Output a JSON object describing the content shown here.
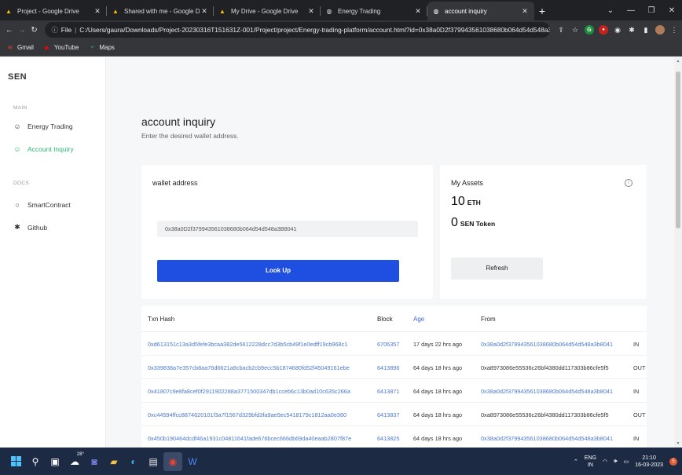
{
  "browser": {
    "tabs": [
      {
        "title": "Project - Google Drive",
        "icon": "google-drive-icon",
        "active": false
      },
      {
        "title": "Shared with me - Google Drive",
        "icon": "google-drive-icon",
        "active": false
      },
      {
        "title": "My Drive - Google Drive",
        "icon": "google-drive-icon",
        "active": false
      },
      {
        "title": "Energy Trading",
        "icon": "globe-icon",
        "active": false
      },
      {
        "title": "account inquiry",
        "icon": "globe-icon",
        "active": true
      }
    ],
    "address": {
      "scheme_label": "File",
      "url": "C:/Users/gaura/Downloads/Project-20230316T151631Z-001/Project/project/Energy-trading-platform/account.html?id=0x38a0D2f379943561038680b064d54d548a3B80..."
    },
    "bookmarks": [
      {
        "label": "Gmail",
        "icon": "gmail-icon"
      },
      {
        "label": "YouTube",
        "icon": "youtube-icon"
      },
      {
        "label": "Maps",
        "icon": "maps-icon"
      }
    ]
  },
  "sidebar": {
    "brand": "SEN",
    "main_label": "MAIN",
    "docs_label": "DOCS",
    "items": [
      {
        "label": "Energy Trading",
        "icon": "bulb-icon",
        "active": false
      },
      {
        "label": "Account Inquiry",
        "icon": "bulb-icon",
        "active": true
      },
      {
        "label": "SmartContract",
        "icon": "circle-icon",
        "active": false
      },
      {
        "label": "Github",
        "icon": "asterisk-icon",
        "active": false
      }
    ]
  },
  "main": {
    "title": "account inquiry",
    "subtitle": "Enter the desired wallet address.",
    "wallet": {
      "label": "wallet address",
      "value": "0x38a0D2f379943561038680b064d54d548a3B8041",
      "button": "Look Up"
    },
    "assets": {
      "title": "My Assets",
      "eth_amount": "10",
      "eth_unit": "ETH",
      "token_amount": "0",
      "token_unit": "SEN Token",
      "refresh": "Refresh"
    },
    "table": {
      "headers": {
        "hash": "Txn Hash",
        "block": "Block",
        "age": "Age",
        "from": "From"
      },
      "rows": [
        {
          "hash": "0xd613151c13a3d5fefe3bcaa382de5612228dcc7d3b5cb49f1e0edff19cb968c1",
          "block": "6706357",
          "age": "17 days 22 hrs ago",
          "from": "0x38a0d2f379943561038680b064d54d548a3b8041",
          "dir": "IN"
        },
        {
          "hash": "0x339838a7e357cb8aa76d6621a8cbacb2cb9ecc5b1874680fd52f45049161ebe",
          "block": "6413896",
          "age": "64 days 18 hrs ago",
          "from": "0xa8973086e55536c26bf4380dd117303b86cfe5f5",
          "dir": "OUT"
        },
        {
          "hash": "0x41807c9e8fa8cef0f2911902288a3771500347db1cceb6c13b0ad10c635c266a",
          "block": "6413871",
          "age": "64 days 18 hrs ago",
          "from": "0x38a0d2f379943561038680b064d54d548a3b8041",
          "dir": "IN"
        },
        {
          "hash": "0xc44594ffcc8874620101f3a7f1567d329bfd3fa9ae5ec5418179c1812aa0e360",
          "block": "6413837",
          "age": "64 days 18 hrs ago",
          "from": "0xa8973086e55536c26bf4380dd117303b86cfe5f5",
          "dir": "OUT"
        },
        {
          "hash": "0x450b190464dcdf46a1931c04811641fade676bcec666db69da40eaab2807f87e",
          "block": "6413825",
          "age": "64 days 18 hrs ago",
          "from": "0x38a0d2f379943561038680b064d54d548a3b8041",
          "dir": "IN"
        }
      ]
    }
  },
  "taskbar": {
    "weather_temp": "28°",
    "lang_top": "ENG",
    "lang_bottom": "IN",
    "time": "21:10",
    "date": "16-03-2023",
    "notification_count": "5"
  },
  "colors": {
    "accent_blue": "#1f4fe0",
    "active_green": "#2bb673",
    "link_blue": "#4a78d0"
  }
}
